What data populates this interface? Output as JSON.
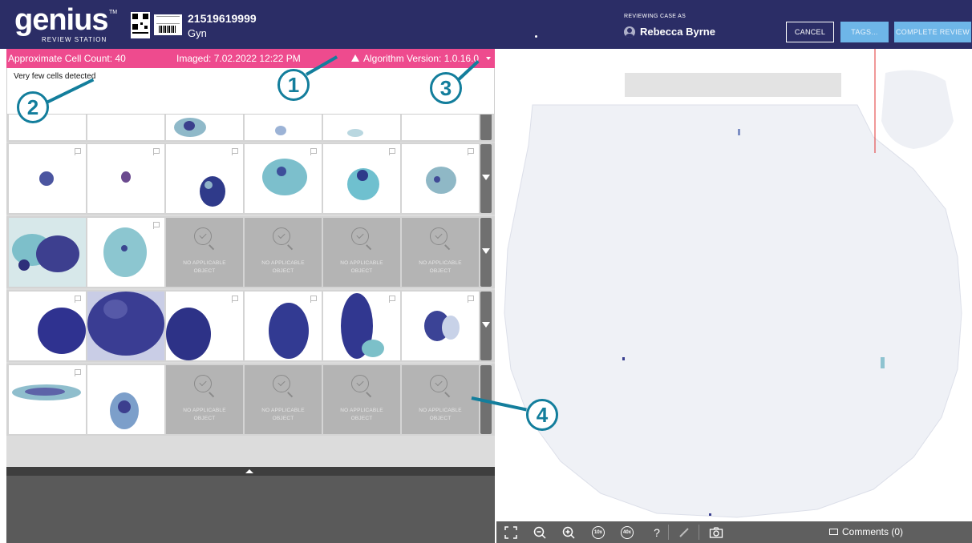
{
  "header": {
    "logo_word": "genius",
    "logo_tm": "TM",
    "logo_subtitle": "REVIEW STATION",
    "case_id": "21519619999",
    "case_type": "Gyn",
    "reviewing_label": "REVIEWING CASE AS",
    "user_name": "Rebecca Byrne",
    "buttons": {
      "cancel": "CANCEL",
      "tags": "TAGS...",
      "complete": "COMPLETE REVIEW"
    }
  },
  "infobar": {
    "cell_count": "Approximate Cell Count: 40",
    "imaged": "Imaged: 7.02.2022 12:22 PM",
    "algorithm": "Algorithm Version: 1.0.16.0",
    "color": "#ee4b8e"
  },
  "message": "Very few cells detected",
  "gallery": {
    "na_line1": "NO APPLICABLE",
    "na_line2": "OBJECT"
  },
  "toolbar": {
    "zoom10": "10x",
    "zoom40": "40x",
    "help": "?",
    "comments": "Comments (0)"
  },
  "callouts": [
    "1",
    "2",
    "3",
    "4"
  ],
  "colors": {
    "header": "#2b2d66",
    "accent": "#6eb6e8",
    "callout": "#137e9c"
  }
}
